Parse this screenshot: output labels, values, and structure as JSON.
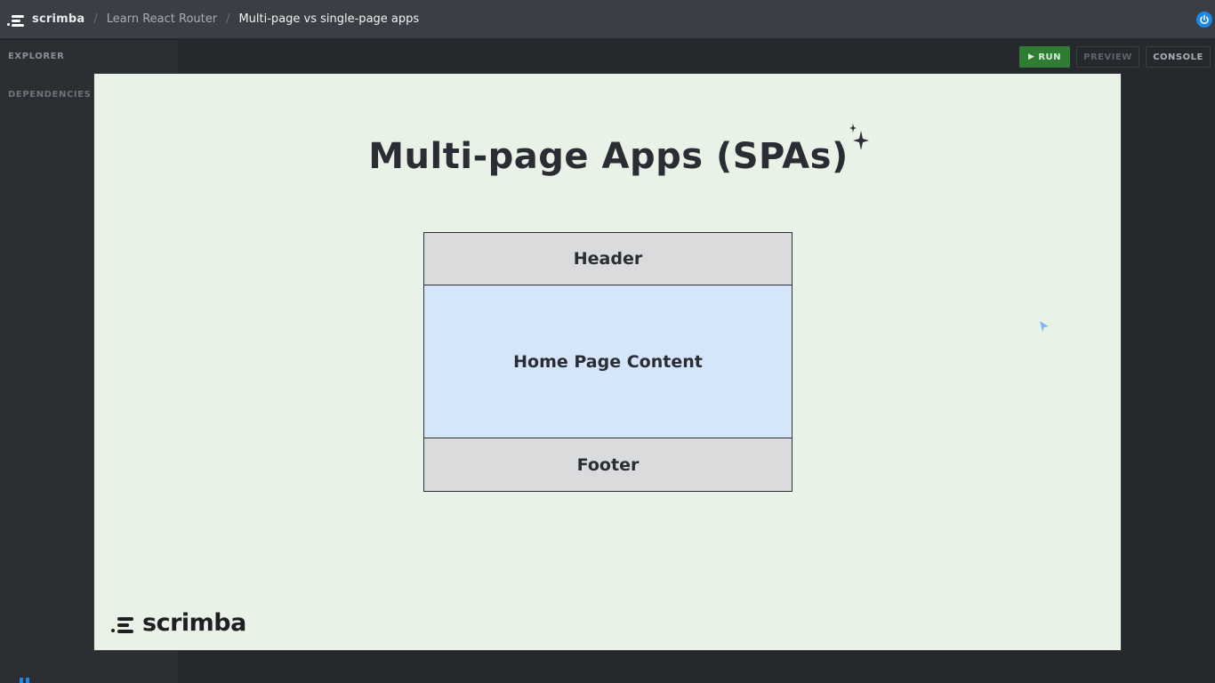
{
  "topbar": {
    "brand": "scrimba",
    "breadcrumb": [
      "Learn React Router",
      "Multi-page vs single-page apps"
    ]
  },
  "sidebar": {
    "tabs": [
      "EXPLORER",
      "DEPENDENCIES"
    ]
  },
  "toolbar": {
    "run_label": "RUN",
    "preview_label": "PREVIEW",
    "console_label": "CONSOLE"
  },
  "slide": {
    "title": "Multi-page Apps (SPAs)",
    "diagram": {
      "header": "Header",
      "content": "Home Page Content",
      "footer": "Footer"
    },
    "logo_text": "scrimba"
  },
  "icons": {
    "power": "power-icon",
    "sparkle": "sparkle-icon",
    "play": "play-icon",
    "cursor": "cursor-icon"
  },
  "colors": {
    "accent_blue": "#1e88e5",
    "run_green": "#2e7d32",
    "slide_bg": "#e8f2e7",
    "content_block": "#d5e6fb",
    "header_footer_block": "#dadbdc"
  }
}
